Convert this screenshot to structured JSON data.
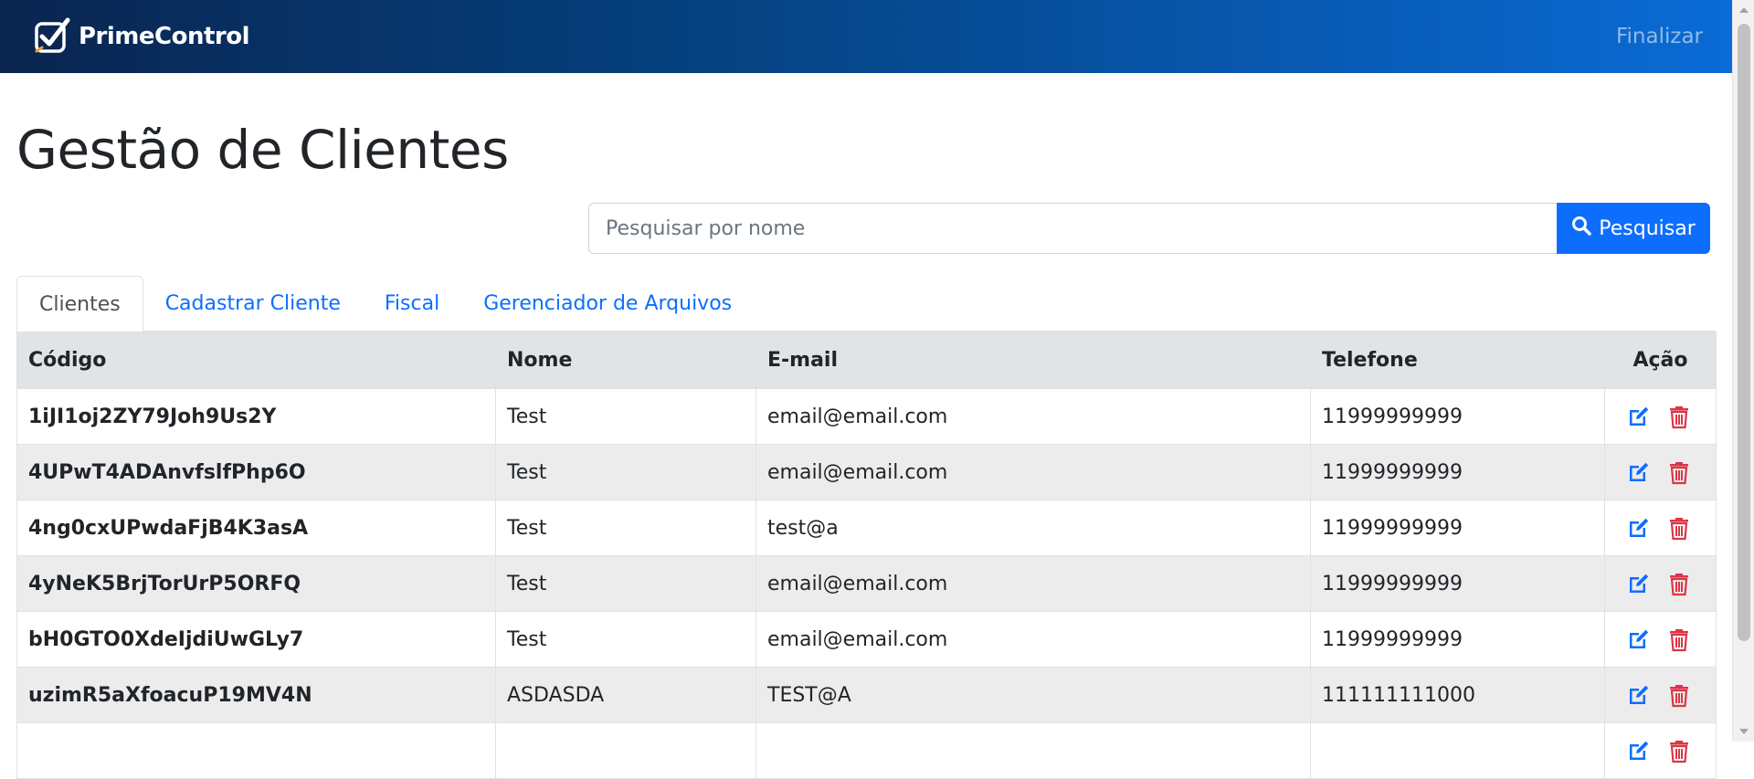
{
  "navbar": {
    "brand_name": "PrimeControl",
    "logout_label": "Finalizar"
  },
  "page": {
    "title": "Gestão de Clientes"
  },
  "search": {
    "placeholder": "Pesquisar por nome",
    "value": "",
    "button_label": "Pesquisar",
    "button_icon": "search-icon"
  },
  "tabs": [
    {
      "label": "Clientes",
      "active": true
    },
    {
      "label": "Cadastrar Cliente",
      "active": false
    },
    {
      "label": "Fiscal",
      "active": false
    },
    {
      "label": "Gerenciador de Arquivos",
      "active": false
    }
  ],
  "table": {
    "columns": [
      "Código",
      "Nome",
      "E-mail",
      "Telefone",
      "Ação"
    ],
    "rows": [
      {
        "code": "1iJI1oj2ZY79Joh9Us2Y",
        "name": "Test",
        "email": "email@email.com",
        "phone": "11999999999"
      },
      {
        "code": "4UPwT4ADAnvfslfPhp6O",
        "name": "Test",
        "email": "email@email.com",
        "phone": "11999999999"
      },
      {
        "code": "4ng0cxUPwdaFjB4K3asA",
        "name": "Test",
        "email": "test@a",
        "phone": "11999999999"
      },
      {
        "code": "4yNeK5BrjTorUrP5ORFQ",
        "name": "Test",
        "email": "email@email.com",
        "phone": "11999999999"
      },
      {
        "code": "bH0GTO0XdeIjdiUwGLy7",
        "name": "Test",
        "email": "email@email.com",
        "phone": "11999999999"
      },
      {
        "code": "uzimR5aXfoacuP19MV4N",
        "name": "ASDASDA",
        "email": "TEST@A",
        "phone": "111111111000"
      },
      {
        "code": "",
        "name": "",
        "email": "",
        "phone": ""
      }
    ],
    "action_icons": [
      "edit-icon",
      "trash-icon"
    ]
  },
  "colors": {
    "primary": "#0d6efd",
    "danger": "#dc3545",
    "navbar_start": "#0a2550",
    "navbar_end": "#0a6bd6",
    "table_header": "#e2e3e5",
    "stripe": "#ececec"
  }
}
